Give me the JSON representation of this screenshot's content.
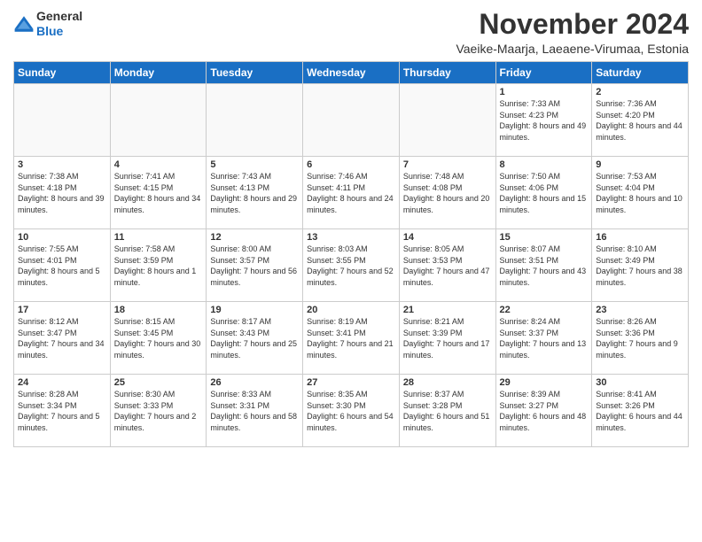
{
  "logo": {
    "general": "General",
    "blue": "Blue"
  },
  "title": "November 2024",
  "location": "Vaeike-Maarja, Laeaene-Virumaa, Estonia",
  "headers": [
    "Sunday",
    "Monday",
    "Tuesday",
    "Wednesday",
    "Thursday",
    "Friday",
    "Saturday"
  ],
  "weeks": [
    [
      {
        "day": "",
        "info": ""
      },
      {
        "day": "",
        "info": ""
      },
      {
        "day": "",
        "info": ""
      },
      {
        "day": "",
        "info": ""
      },
      {
        "day": "",
        "info": ""
      },
      {
        "day": "1",
        "info": "Sunrise: 7:33 AM\nSunset: 4:23 PM\nDaylight: 8 hours and 49 minutes."
      },
      {
        "day": "2",
        "info": "Sunrise: 7:36 AM\nSunset: 4:20 PM\nDaylight: 8 hours and 44 minutes."
      }
    ],
    [
      {
        "day": "3",
        "info": "Sunrise: 7:38 AM\nSunset: 4:18 PM\nDaylight: 8 hours and 39 minutes."
      },
      {
        "day": "4",
        "info": "Sunrise: 7:41 AM\nSunset: 4:15 PM\nDaylight: 8 hours and 34 minutes."
      },
      {
        "day": "5",
        "info": "Sunrise: 7:43 AM\nSunset: 4:13 PM\nDaylight: 8 hours and 29 minutes."
      },
      {
        "day": "6",
        "info": "Sunrise: 7:46 AM\nSunset: 4:11 PM\nDaylight: 8 hours and 24 minutes."
      },
      {
        "day": "7",
        "info": "Sunrise: 7:48 AM\nSunset: 4:08 PM\nDaylight: 8 hours and 20 minutes."
      },
      {
        "day": "8",
        "info": "Sunrise: 7:50 AM\nSunset: 4:06 PM\nDaylight: 8 hours and 15 minutes."
      },
      {
        "day": "9",
        "info": "Sunrise: 7:53 AM\nSunset: 4:04 PM\nDaylight: 8 hours and 10 minutes."
      }
    ],
    [
      {
        "day": "10",
        "info": "Sunrise: 7:55 AM\nSunset: 4:01 PM\nDaylight: 8 hours and 5 minutes."
      },
      {
        "day": "11",
        "info": "Sunrise: 7:58 AM\nSunset: 3:59 PM\nDaylight: 8 hours and 1 minute."
      },
      {
        "day": "12",
        "info": "Sunrise: 8:00 AM\nSunset: 3:57 PM\nDaylight: 7 hours and 56 minutes."
      },
      {
        "day": "13",
        "info": "Sunrise: 8:03 AM\nSunset: 3:55 PM\nDaylight: 7 hours and 52 minutes."
      },
      {
        "day": "14",
        "info": "Sunrise: 8:05 AM\nSunset: 3:53 PM\nDaylight: 7 hours and 47 minutes."
      },
      {
        "day": "15",
        "info": "Sunrise: 8:07 AM\nSunset: 3:51 PM\nDaylight: 7 hours and 43 minutes."
      },
      {
        "day": "16",
        "info": "Sunrise: 8:10 AM\nSunset: 3:49 PM\nDaylight: 7 hours and 38 minutes."
      }
    ],
    [
      {
        "day": "17",
        "info": "Sunrise: 8:12 AM\nSunset: 3:47 PM\nDaylight: 7 hours and 34 minutes."
      },
      {
        "day": "18",
        "info": "Sunrise: 8:15 AM\nSunset: 3:45 PM\nDaylight: 7 hours and 30 minutes."
      },
      {
        "day": "19",
        "info": "Sunrise: 8:17 AM\nSunset: 3:43 PM\nDaylight: 7 hours and 25 minutes."
      },
      {
        "day": "20",
        "info": "Sunrise: 8:19 AM\nSunset: 3:41 PM\nDaylight: 7 hours and 21 minutes."
      },
      {
        "day": "21",
        "info": "Sunrise: 8:21 AM\nSunset: 3:39 PM\nDaylight: 7 hours and 17 minutes."
      },
      {
        "day": "22",
        "info": "Sunrise: 8:24 AM\nSunset: 3:37 PM\nDaylight: 7 hours and 13 minutes."
      },
      {
        "day": "23",
        "info": "Sunrise: 8:26 AM\nSunset: 3:36 PM\nDaylight: 7 hours and 9 minutes."
      }
    ],
    [
      {
        "day": "24",
        "info": "Sunrise: 8:28 AM\nSunset: 3:34 PM\nDaylight: 7 hours and 5 minutes."
      },
      {
        "day": "25",
        "info": "Sunrise: 8:30 AM\nSunset: 3:33 PM\nDaylight: 7 hours and 2 minutes."
      },
      {
        "day": "26",
        "info": "Sunrise: 8:33 AM\nSunset: 3:31 PM\nDaylight: 6 hours and 58 minutes."
      },
      {
        "day": "27",
        "info": "Sunrise: 8:35 AM\nSunset: 3:30 PM\nDaylight: 6 hours and 54 minutes."
      },
      {
        "day": "28",
        "info": "Sunrise: 8:37 AM\nSunset: 3:28 PM\nDaylight: 6 hours and 51 minutes."
      },
      {
        "day": "29",
        "info": "Sunrise: 8:39 AM\nSunset: 3:27 PM\nDaylight: 6 hours and 48 minutes."
      },
      {
        "day": "30",
        "info": "Sunrise: 8:41 AM\nSunset: 3:26 PM\nDaylight: 6 hours and 44 minutes."
      }
    ]
  ]
}
